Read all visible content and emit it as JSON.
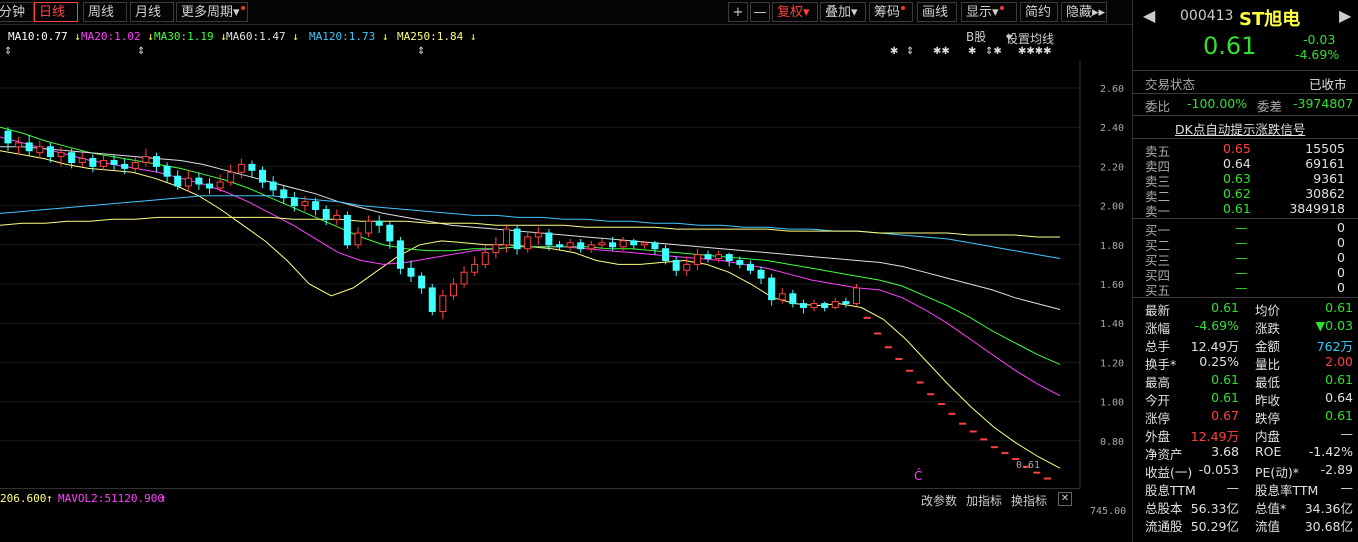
{
  "toolbar": {
    "tabs": [
      "分钟",
      "日线",
      "周线",
      "月线",
      "更多周期"
    ],
    "right_buttons": [
      "+",
      "—",
      "复权",
      "叠加",
      "筹码",
      "画线",
      "显示",
      "简约",
      "隐藏"
    ]
  },
  "ma_legend": [
    {
      "label": "MA10:0.77",
      "arrow": "↓",
      "color": "#ffffff"
    },
    {
      "label": "MA20:1.02",
      "arrow": "↓",
      "color": "#ff40ff"
    },
    {
      "label": "MA30:1.19",
      "arrow": "↓",
      "color": "#40ff40"
    },
    {
      "label": "MA60:1.47",
      "arrow": "↓",
      "color": "#e0e0e0"
    },
    {
      "label": "MA120:1.73",
      "arrow": "↓",
      "color": "#40c8ff"
    },
    {
      "label": "MA250:1.84",
      "arrow": "↓",
      "color": "#ffff80"
    }
  ],
  "b_label": "B股",
  "ma_settings": "设置均线",
  "markers": [
    "⇕",
    "⇕",
    "⇕",
    "✱",
    "⇕",
    "✱✱",
    "✱",
    "⇕✱",
    "✱✱✱✱"
  ],
  "y_axis": [
    "2.60",
    "2.40",
    "2.20",
    "2.00",
    "1.80",
    "1.60",
    "1.40",
    "1.20",
    "1.00",
    "0.80"
  ],
  "last_price_label": "0.61",
  "vol_row": {
    "vol": "206.600",
    "mavol2": "MAVOL2:51120.900",
    "arrow": "↑"
  },
  "vol_axis": "745.00",
  "tools": [
    "改参数",
    "加指标",
    "换指标"
  ],
  "panel": {
    "code": "000413",
    "name": "ST旭电",
    "price": "0.61",
    "change": "-0.03",
    "change_pct": "-4.69%",
    "trade_state_label": "交易状态",
    "trade_state": "已收市",
    "wb_label": "委比",
    "wb": "-100.00%",
    "wc_label": "委差",
    "wc": "-3974807",
    "dk_link": "DK点自动提示涨跌信号",
    "asks": [
      {
        "label": "卖五",
        "price": "0.65",
        "vol": "15505"
      },
      {
        "label": "卖四",
        "price": "0.64",
        "vol": "69161"
      },
      {
        "label": "卖三",
        "price": "0.63",
        "vol": "9361"
      },
      {
        "label": "卖二",
        "price": "0.62",
        "vol": "30862"
      },
      {
        "label": "卖一",
        "price": "0.61",
        "vol": "3849918"
      }
    ],
    "bids": [
      {
        "label": "买一",
        "price": "—",
        "vol": "0"
      },
      {
        "label": "买二",
        "price": "—",
        "vol": "0"
      },
      {
        "label": "买三",
        "price": "—",
        "vol": "0"
      },
      {
        "label": "买四",
        "price": "—",
        "vol": "0"
      },
      {
        "label": "买五",
        "price": "—",
        "vol": "0"
      }
    ],
    "stats": [
      [
        "最新",
        "0.61",
        "均价",
        "0.61"
      ],
      [
        "涨幅",
        "-4.69%",
        "涨跌",
        "▼0.03"
      ],
      [
        "总手",
        "12.49万",
        "金额",
        "762万"
      ],
      [
        "换手*",
        "0.25%",
        "量比",
        "2.00"
      ],
      [
        "最高",
        "0.61",
        "最低",
        "0.61"
      ],
      [
        "今开",
        "0.61",
        "昨收",
        "0.64"
      ],
      [
        "涨停",
        "0.67",
        "跌停",
        "0.61"
      ],
      [
        "外盘",
        "12.49万",
        "内盘",
        "—"
      ],
      [
        "净资产",
        "3.68",
        "ROE",
        "-1.42%"
      ],
      [
        "收益(一)",
        "-0.053",
        "PE(动)*",
        "-2.89"
      ],
      [
        "股息TTM",
        "—",
        "股息率TTM",
        "—"
      ],
      [
        "总股本",
        "56.33亿",
        "总值*",
        "34.36亿"
      ],
      [
        "流通股",
        "50.29亿",
        "流值",
        "30.68亿"
      ]
    ]
  },
  "chart_data": {
    "type": "candlestick",
    "y_range": [
      0.6,
      2.6
    ],
    "candles": [
      [
        2.38,
        2.32,
        2.4,
        2.28
      ],
      [
        2.3,
        2.32,
        2.35,
        2.26
      ],
      [
        2.32,
        2.28,
        2.36,
        2.25
      ],
      [
        2.27,
        2.3,
        2.33,
        2.24
      ],
      [
        2.3,
        2.25,
        2.32,
        2.22
      ],
      [
        2.25,
        2.27,
        2.3,
        2.2
      ],
      [
        2.27,
        2.22,
        2.29,
        2.19
      ],
      [
        2.22,
        2.24,
        2.27,
        2.2
      ],
      [
        2.24,
        2.2,
        2.26,
        2.17
      ],
      [
        2.2,
        2.23,
        2.27,
        2.18
      ],
      [
        2.23,
        2.21,
        2.26,
        2.18
      ],
      [
        2.21,
        2.19,
        2.24,
        2.16
      ],
      [
        2.19,
        2.22,
        2.25,
        2.17
      ],
      [
        2.22,
        2.25,
        2.29,
        2.2
      ],
      [
        2.25,
        2.2,
        2.27,
        2.17
      ],
      [
        2.2,
        2.15,
        2.22,
        2.12
      ],
      [
        2.15,
        2.1,
        2.18,
        2.08
      ],
      [
        2.1,
        2.14,
        2.18,
        2.07
      ],
      [
        2.14,
        2.11,
        2.17,
        2.08
      ],
      [
        2.11,
        2.09,
        2.14,
        2.06
      ],
      [
        2.09,
        2.12,
        2.16,
        2.07
      ],
      [
        2.12,
        2.17,
        2.21,
        2.1
      ],
      [
        2.17,
        2.21,
        2.24,
        2.14
      ],
      [
        2.21,
        2.18,
        2.23,
        2.14
      ],
      [
        2.18,
        2.12,
        2.2,
        2.09
      ],
      [
        2.12,
        2.08,
        2.15,
        2.05
      ],
      [
        2.08,
        2.04,
        2.1,
        2.01
      ],
      [
        2.04,
        2.0,
        2.07,
        1.97
      ],
      [
        2.0,
        2.02,
        2.05,
        1.97
      ],
      [
        2.02,
        1.98,
        2.04,
        1.95
      ],
      [
        1.98,
        1.93,
        2.0,
        1.9
      ],
      [
        1.93,
        1.95,
        1.98,
        1.9
      ],
      [
        1.95,
        1.8,
        1.97,
        1.78
      ],
      [
        1.8,
        1.86,
        1.89,
        1.78
      ],
      [
        1.86,
        1.92,
        1.95,
        1.84
      ],
      [
        1.92,
        1.9,
        1.95,
        1.86
      ],
      [
        1.9,
        1.82,
        1.92,
        1.78
      ],
      [
        1.82,
        1.68,
        1.84,
        1.65
      ],
      [
        1.68,
        1.64,
        1.72,
        1.61
      ],
      [
        1.64,
        1.58,
        1.66,
        1.55
      ],
      [
        1.58,
        1.46,
        1.6,
        1.44
      ],
      [
        1.46,
        1.54,
        1.57,
        1.42
      ],
      [
        1.54,
        1.6,
        1.63,
        1.52
      ],
      [
        1.6,
        1.66,
        1.69,
        1.58
      ],
      [
        1.66,
        1.7,
        1.74,
        1.64
      ],
      [
        1.7,
        1.76,
        1.8,
        1.68
      ],
      [
        1.76,
        1.8,
        1.84,
        1.73
      ],
      [
        1.8,
        1.88,
        1.9,
        1.76
      ],
      [
        1.88,
        1.78,
        1.9,
        1.75
      ],
      [
        1.78,
        1.84,
        1.87,
        1.76
      ],
      [
        1.84,
        1.86,
        1.89,
        1.8
      ],
      [
        1.86,
        1.8,
        1.88,
        1.77
      ],
      [
        1.8,
        1.79,
        1.82,
        1.77
      ],
      [
        1.79,
        1.81,
        1.83,
        1.77
      ],
      [
        1.81,
        1.78,
        1.83,
        1.76
      ],
      [
        1.78,
        1.8,
        1.82,
        1.76
      ],
      [
        1.8,
        1.81,
        1.83,
        1.78
      ],
      [
        1.81,
        1.79,
        1.84,
        1.77
      ],
      [
        1.79,
        1.82,
        1.84,
        1.77
      ],
      [
        1.82,
        1.8,
        1.83,
        1.78
      ],
      [
        1.8,
        1.81,
        1.82,
        1.78
      ],
      [
        1.81,
        1.78,
        1.82,
        1.75
      ],
      [
        1.78,
        1.72,
        1.8,
        1.7
      ],
      [
        1.72,
        1.67,
        1.74,
        1.64
      ],
      [
        1.67,
        1.7,
        1.74,
        1.64
      ],
      [
        1.7,
        1.75,
        1.78,
        1.67
      ],
      [
        1.75,
        1.73,
        1.77,
        1.71
      ],
      [
        1.73,
        1.75,
        1.77,
        1.71
      ],
      [
        1.75,
        1.72,
        1.76,
        1.69
      ],
      [
        1.72,
        1.7,
        1.74,
        1.68
      ],
      [
        1.7,
        1.67,
        1.72,
        1.65
      ],
      [
        1.67,
        1.63,
        1.69,
        1.6
      ],
      [
        1.63,
        1.52,
        1.65,
        1.49
      ],
      [
        1.52,
        1.55,
        1.58,
        1.5
      ],
      [
        1.55,
        1.5,
        1.57,
        1.48
      ],
      [
        1.5,
        1.48,
        1.52,
        1.45
      ],
      [
        1.48,
        1.5,
        1.52,
        1.46
      ],
      [
        1.5,
        1.48,
        1.51,
        1.46
      ],
      [
        1.48,
        1.51,
        1.53,
        1.47
      ],
      [
        1.51,
        1.5,
        1.53,
        1.48
      ],
      [
        1.5,
        1.58,
        1.6,
        1.49
      ],
      [
        1.43,
        1.43,
        1.43,
        1.43
      ],
      [
        1.35,
        1.35,
        1.35,
        1.35
      ],
      [
        1.28,
        1.28,
        1.28,
        1.28
      ],
      [
        1.22,
        1.22,
        1.22,
        1.22
      ],
      [
        1.16,
        1.16,
        1.16,
        1.16
      ],
      [
        1.1,
        1.1,
        1.1,
        1.1
      ],
      [
        1.04,
        1.04,
        1.04,
        1.04
      ],
      [
        0.99,
        0.99,
        0.99,
        0.99
      ],
      [
        0.94,
        0.94,
        0.94,
        0.94
      ],
      [
        0.89,
        0.89,
        0.89,
        0.89
      ],
      [
        0.85,
        0.85,
        0.85,
        0.85
      ],
      [
        0.81,
        0.81,
        0.81,
        0.81
      ],
      [
        0.77,
        0.77,
        0.77,
        0.77
      ],
      [
        0.74,
        0.74,
        0.74,
        0.74
      ],
      [
        0.71,
        0.71,
        0.71,
        0.71
      ],
      [
        0.67,
        0.67,
        0.67,
        0.67
      ],
      [
        0.64,
        0.64,
        0.64,
        0.64
      ],
      [
        0.61,
        0.61,
        0.61,
        0.61
      ]
    ],
    "ma_lines": [
      {
        "name": "MA10",
        "color": "#ffff80",
        "points": [
          2.28,
          2.26,
          2.24,
          2.21,
          2.19,
          2.18,
          2.17,
          2.14,
          2.1,
          2.05,
          1.98,
          1.9,
          1.82,
          1.72,
          1.6,
          1.54,
          1.58,
          1.66,
          1.74,
          1.8,
          1.82,
          1.81,
          1.8,
          1.8,
          1.79,
          1.78,
          1.76,
          1.72,
          1.7,
          1.7,
          1.71,
          1.72,
          1.7,
          1.66,
          1.6,
          1.53,
          1.5,
          1.49,
          1.5,
          1.48,
          1.42,
          1.32,
          1.2,
          1.08,
          0.97,
          0.87,
          0.79,
          0.72,
          0.66
        ]
      },
      {
        "name": "MA20",
        "color": "#ff40ff",
        "points": [
          2.35,
          2.32,
          2.29,
          2.26,
          2.23,
          2.21,
          2.19,
          2.17,
          2.14,
          2.11,
          2.07,
          2.02,
          1.96,
          1.9,
          1.83,
          1.76,
          1.72,
          1.7,
          1.71,
          1.73,
          1.75,
          1.77,
          1.78,
          1.79,
          1.79,
          1.79,
          1.78,
          1.77,
          1.76,
          1.75,
          1.74,
          1.73,
          1.72,
          1.7,
          1.68,
          1.65,
          1.62,
          1.6,
          1.58,
          1.57,
          1.53,
          1.47,
          1.4,
          1.32,
          1.24,
          1.16,
          1.09,
          1.03
        ]
      },
      {
        "name": "MA30",
        "color": "#40ff40",
        "points": [
          2.4,
          2.37,
          2.33,
          2.3,
          2.27,
          2.25,
          2.23,
          2.21,
          2.19,
          2.16,
          2.13,
          2.09,
          2.04,
          1.99,
          1.94,
          1.89,
          1.84,
          1.8,
          1.78,
          1.77,
          1.77,
          1.78,
          1.78,
          1.79,
          1.79,
          1.79,
          1.79,
          1.78,
          1.78,
          1.77,
          1.76,
          1.75,
          1.74,
          1.73,
          1.72,
          1.7,
          1.68,
          1.66,
          1.64,
          1.62,
          1.59,
          1.54,
          1.49,
          1.43,
          1.36,
          1.3,
          1.24,
          1.19
        ]
      },
      {
        "name": "MA60",
        "color": "#e0e0e0",
        "points": [
          2.3,
          2.3,
          2.29,
          2.28,
          2.27,
          2.26,
          2.25,
          2.24,
          2.23,
          2.21,
          2.18,
          2.15,
          2.12,
          2.09,
          2.06,
          2.02,
          1.99,
          1.96,
          1.94,
          1.92,
          1.9,
          1.89,
          1.88,
          1.87,
          1.86,
          1.85,
          1.84,
          1.83,
          1.82,
          1.81,
          1.8,
          1.79,
          1.78,
          1.77,
          1.76,
          1.75,
          1.74,
          1.73,
          1.72,
          1.71,
          1.69,
          1.66,
          1.63,
          1.6,
          1.57,
          1.53,
          1.5,
          1.47
        ]
      },
      {
        "name": "MA120",
        "color": "#40c8ff",
        "points": [
          1.96,
          1.97,
          1.98,
          1.99,
          2.0,
          2.01,
          2.02,
          2.03,
          2.04,
          2.05,
          2.05,
          2.05,
          2.05,
          2.04,
          2.03,
          2.02,
          2.0,
          1.99,
          1.98,
          1.97,
          1.96,
          1.95,
          1.95,
          1.94,
          1.94,
          1.93,
          1.93,
          1.92,
          1.92,
          1.91,
          1.91,
          1.9,
          1.9,
          1.89,
          1.89,
          1.88,
          1.88,
          1.87,
          1.87,
          1.86,
          1.85,
          1.84,
          1.83,
          1.81,
          1.79,
          1.77,
          1.75,
          1.73
        ]
      },
      {
        "name": "MA250",
        "color": "#ffff80",
        "points": [
          1.9,
          1.91,
          1.91,
          1.92,
          1.92,
          1.93,
          1.93,
          1.94,
          1.94,
          1.94,
          1.94,
          1.94,
          1.94,
          1.93,
          1.93,
          1.93,
          1.92,
          1.92,
          1.92,
          1.91,
          1.91,
          1.91,
          1.9,
          1.9,
          1.9,
          1.9,
          1.89,
          1.89,
          1.89,
          1.89,
          1.88,
          1.88,
          1.88,
          1.88,
          1.88,
          1.87,
          1.87,
          1.87,
          1.87,
          1.86,
          1.86,
          1.86,
          1.86,
          1.85,
          1.85,
          1.85,
          1.84,
          1.84
        ]
      }
    ]
  }
}
